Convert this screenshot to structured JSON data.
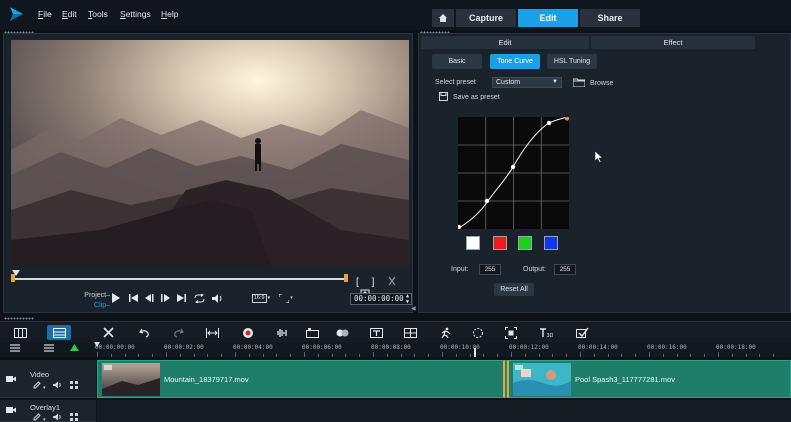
{
  "menu": {
    "items": [
      {
        "label": "File",
        "underline": "F"
      },
      {
        "label": "Edit",
        "underline": "E"
      },
      {
        "label": "Tools",
        "underline": "T"
      },
      {
        "label": "Settings",
        "underline": "S"
      },
      {
        "label": "Help",
        "underline": "H"
      }
    ]
  },
  "workspace_tabs": {
    "home_icon": "home-icon",
    "capture": "Capture",
    "edit": "Edit",
    "share": "Share",
    "active": "Edit"
  },
  "preview": {
    "mode_project": "Project",
    "mode_clip": "Clip",
    "timecode": "00:00:00:00",
    "aspect": "16:9",
    "trim_start": "[",
    "trim_end": "]"
  },
  "edit_panel": {
    "tab_edit": "Edit",
    "tab_effect": "Effect",
    "mode_basic": "Basic",
    "mode_tone_curve": "Tone Curve",
    "mode_hsl": "HSL Tuning",
    "active_mode": "Tone Curve",
    "select_preset_label": "Select preset",
    "preset_value": "Custom",
    "browse_label": "Browse",
    "save_preset_label": "Save as preset",
    "channel_swatches": [
      {
        "name": "white",
        "color": "#ffffff"
      },
      {
        "name": "red",
        "color": "#ee1c1c"
      },
      {
        "name": "green",
        "color": "#1ad21a"
      },
      {
        "name": "blue",
        "color": "#1236f0"
      }
    ],
    "input_label": "Input:",
    "input_value": "255",
    "output_label": "Output:",
    "output_value": "255",
    "reset_label": "Reset All"
  },
  "ruler": {
    "labels": [
      "00:00:00:00",
      "00:00:02:00",
      "00:00:04:00",
      "00:00:06:00",
      "00:00:08:00",
      "00:00:10:00",
      "00:00:12:00",
      "00:00:14:00",
      "00:00:16:00",
      "00:00:18:00"
    ]
  },
  "tracks": {
    "video_name": "Video",
    "overlay_name": "Overlay1",
    "clip1_name": "Mountain_18379717.mov",
    "clip2_name": "Pool Spash3_117777281.mov"
  },
  "colors": {
    "accent": "#1aa0e6",
    "clip_fill": "#1f7e6a",
    "trim_mark": "#e8a33a"
  }
}
